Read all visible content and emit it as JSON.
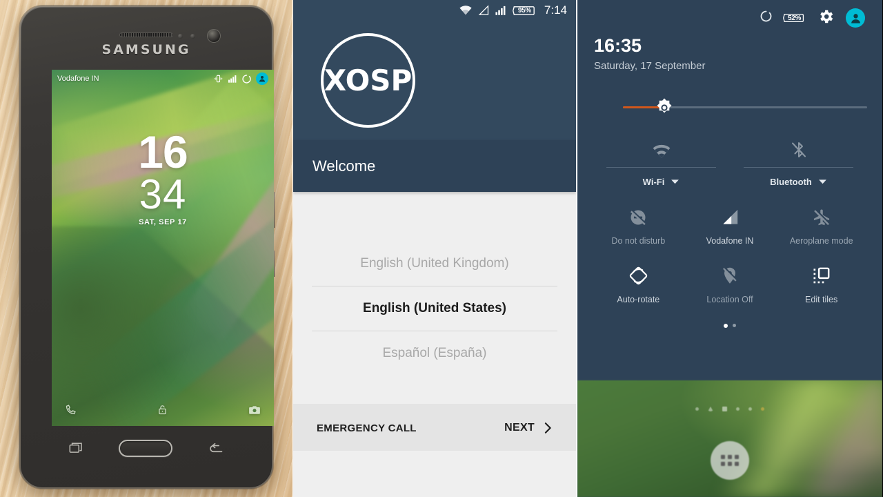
{
  "phone_panel": {
    "device_brand": "SAMSUNG",
    "lockscreen": {
      "carrier": "Vodafone IN",
      "hour": "16",
      "minute": "34",
      "date": "SAT, SEP 17",
      "status_icons": [
        "vibrate-icon",
        "signal-bars-icon",
        "sync-circle-icon",
        "user-avatar-icon"
      ],
      "shortcuts": [
        "phone-icon",
        "lock-icon",
        "camera-icon"
      ]
    },
    "navbar": [
      "recents-icon",
      "home-button",
      "back-icon"
    ]
  },
  "setup_panel": {
    "statusbar": {
      "icons": [
        "wifi-icon",
        "signal-empty-icon",
        "signal-bars-icon"
      ],
      "battery_percent": "95%",
      "time": "7:14"
    },
    "logo_text": "XOSP",
    "title": "Welcome",
    "languages": [
      {
        "label": "English (United Kingdom)",
        "selected": false
      },
      {
        "label": "English (United States)",
        "selected": true
      },
      {
        "label": "Español (España)",
        "selected": false
      }
    ],
    "footer": {
      "emergency_label": "EMERGENCY CALL",
      "next_label": "NEXT",
      "next_icon": "chevron-right-icon"
    }
  },
  "quicksettings_panel": {
    "statusbar": {
      "icons": [
        "sync-circle-icon",
        "gear-icon",
        "user-avatar-icon"
      ],
      "battery_percent": "52%"
    },
    "clock": "16:35",
    "date": "Saturday, 17 September",
    "brightness": {
      "value_percent": 16,
      "icon": "brightness-sun-icon"
    },
    "wide_tiles": [
      {
        "label": "Wi-Fi",
        "icon": "wifi-icon",
        "active": false,
        "expandable": true
      },
      {
        "label": "Bluetooth",
        "icon": "bluetooth-off-icon",
        "active": false,
        "expandable": true
      }
    ],
    "tiles_row_1": [
      {
        "label": "Do not disturb",
        "icon": "do-not-disturb-off-icon",
        "active": false
      },
      {
        "label": "Vodafone IN",
        "icon": "cell-signal-icon",
        "active": true
      },
      {
        "label": "Aeroplane mode",
        "icon": "airplane-off-icon",
        "active": false
      }
    ],
    "tiles_row_2": [
      {
        "label": "Auto-rotate",
        "icon": "auto-rotate-icon",
        "active": true
      },
      {
        "label": "Location Off",
        "icon": "location-off-icon",
        "active": false
      },
      {
        "label": "Edit tiles",
        "icon": "edit-tiles-icon",
        "active": true
      }
    ],
    "page_dots": {
      "count": 2,
      "active_index": 0
    },
    "homescreen": {
      "app_drawer_icon": "app-drawer-icon"
    }
  },
  "colors": {
    "shade_background": "#2e4257",
    "hero_background": "#33495e",
    "accent_cyan": "#00bcd4",
    "brightness_fill": "#d1571b",
    "setup_body": "#efefef",
    "setup_footer": "#e4e4e4"
  }
}
